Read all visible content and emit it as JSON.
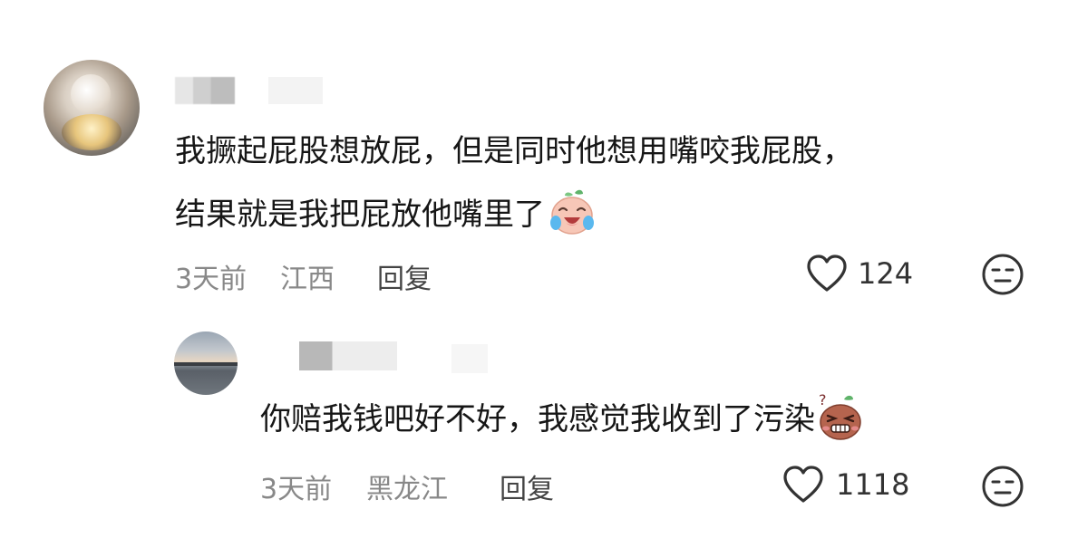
{
  "comments": [
    {
      "text_line1": "我撅起屁股想放屁，但是同时他想用嘴咬我屁股，",
      "text_line2": "结果就是我把屁放他嘴里了",
      "emoji": "laughing-crying-face-emoji",
      "time": "3天前",
      "location": "江西",
      "reply_label": "回复",
      "likes": "124"
    },
    {
      "text_line1": "你赔我钱吧好不好，我感觉我收到了污染",
      "emoji": "grimacing-bean-face-emoji",
      "time": "3天前",
      "location": "黑龙江",
      "reply_label": "回复",
      "likes": "1118"
    }
  ],
  "icons": {
    "like": "heart-outline-icon",
    "dislike": "neutral-face-outline-icon"
  }
}
